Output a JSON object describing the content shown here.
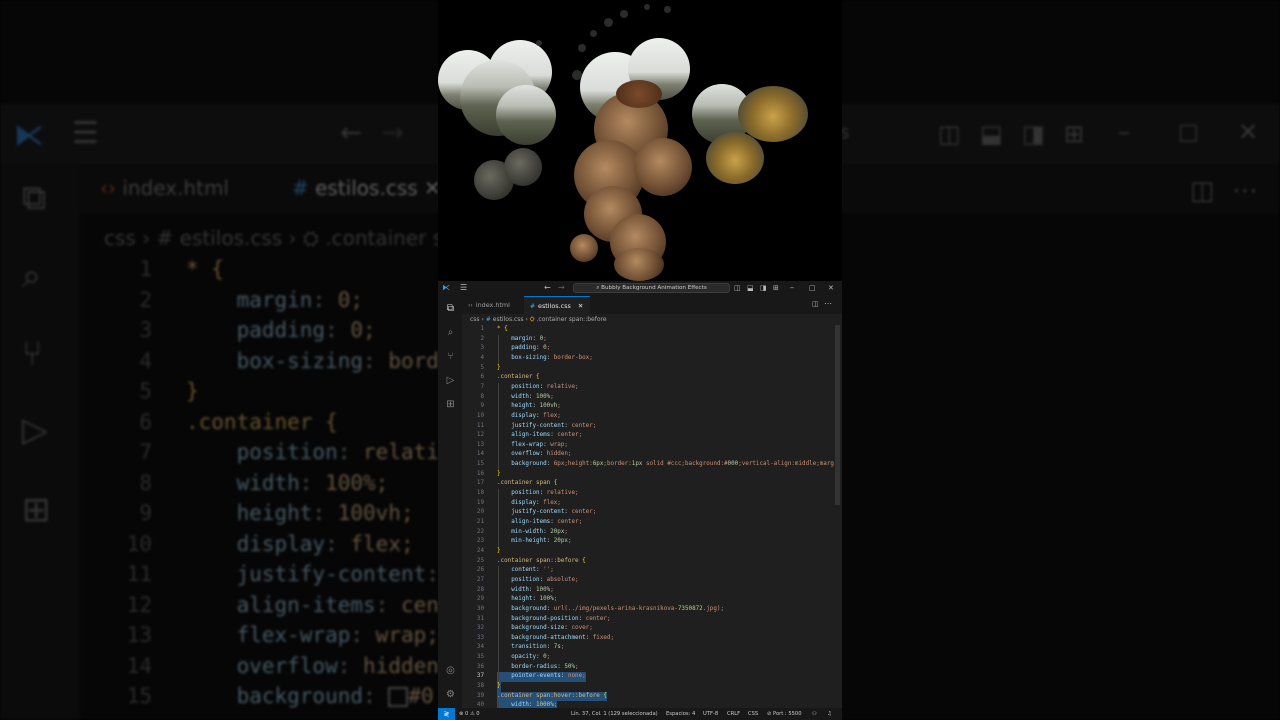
{
  "app": {
    "title": "Bubbly Background Animation Effects"
  },
  "tabs": [
    {
      "label": "index.html",
      "icon": "html-file-icon",
      "active": false
    },
    {
      "label": "estilos.css",
      "icon": "css-file-icon",
      "active": true,
      "close": "✕"
    }
  ],
  "breadcrumb": {
    "folder": "css",
    "file": "estilos.css",
    "symbol": ".container span::before",
    "sep": "›"
  },
  "editor": {
    "lines": [
      {
        "n": "1",
        "code": "* {"
      },
      {
        "n": "2",
        "code": "    margin: 0;"
      },
      {
        "n": "3",
        "code": "    padding: 0;"
      },
      {
        "n": "4",
        "code": "    box-sizing: border-box;"
      },
      {
        "n": "5",
        "code": "}"
      },
      {
        "n": "6",
        "code": ".container {"
      },
      {
        "n": "7",
        "code": "    position: relative;"
      },
      {
        "n": "8",
        "code": "    width: 100%;"
      },
      {
        "n": "9",
        "code": "    height: 100vh;"
      },
      {
        "n": "10",
        "code": "    display: flex;"
      },
      {
        "n": "11",
        "code": "    justify-content: center;"
      },
      {
        "n": "12",
        "code": "    align-items: center;"
      },
      {
        "n": "13",
        "code": "    flex-wrap: wrap;"
      },
      {
        "n": "14",
        "code": "    overflow: hidden;"
      },
      {
        "n": "15",
        "code": "    background: ■#000;"
      },
      {
        "n": "16",
        "code": "}"
      },
      {
        "n": "17",
        "code": ".container span {"
      },
      {
        "n": "18",
        "code": "    position: relative;"
      },
      {
        "n": "19",
        "code": "    display: flex;"
      },
      {
        "n": "20",
        "code": "    justify-content: center;"
      },
      {
        "n": "21",
        "code": "    align-items: center;"
      },
      {
        "n": "22",
        "code": "    min-width: 20px;"
      },
      {
        "n": "23",
        "code": "    min-height: 20px;"
      },
      {
        "n": "24",
        "code": "}"
      },
      {
        "n": "25",
        "code": ".container span::before {"
      },
      {
        "n": "26",
        "code": "    content: '';"
      },
      {
        "n": "27",
        "code": "    position: absolute;"
      },
      {
        "n": "28",
        "code": "    width: 100%;"
      },
      {
        "n": "29",
        "code": "    height: 100%;"
      },
      {
        "n": "30",
        "code": "    background: url(../img/pexels-arina-krasnikova-7350872.jpg);"
      },
      {
        "n": "31",
        "code": "    background-position: center;"
      },
      {
        "n": "32",
        "code": "    background-size: cover;"
      },
      {
        "n": "33",
        "code": "    background-attachment: fixed;"
      },
      {
        "n": "34",
        "code": "    transition: 7s;"
      },
      {
        "n": "35",
        "code": "    opacity: 0;"
      },
      {
        "n": "36",
        "code": "    border-radius: 50%;"
      },
      {
        "n": "37",
        "code": "    pointer-events: none;"
      },
      {
        "n": "38",
        "code": "}"
      },
      {
        "n": "39",
        "code": ".container span:hover::before {"
      },
      {
        "n": "40",
        "code": "    width: 1000%;"
      }
    ],
    "current_line": "37",
    "selected_lines": [
      "37",
      "38",
      "39",
      "40"
    ]
  },
  "status": {
    "remote": "≷",
    "problems": "⊗ 0 ⚠ 0",
    "position": "Lín. 37, Col. 1 (129 seleccionada)",
    "spaces": "Espacios: 4",
    "encoding": "UTF-8",
    "eol": "CRLF",
    "language": "CSS",
    "port": "Port : 5500"
  },
  "background": {
    "tabs": [
      {
        "label": "index.html"
      },
      {
        "label": "estilos.css"
      }
    ],
    "crumb": "css  ›  #  estilos.css  ›  ⛭ .container s",
    "lines": [
      {
        "n": "1",
        "code": "* {"
      },
      {
        "n": "2",
        "code": "    margin: 0;"
      },
      {
        "n": "3",
        "code": "    padding: 0;"
      },
      {
        "n": "4",
        "code": "    box-sizing: borde"
      },
      {
        "n": "5",
        "code": "}"
      },
      {
        "n": "6",
        "code": ".container {"
      },
      {
        "n": "7",
        "code": "    position: relativ"
      },
      {
        "n": "8",
        "code": "    width: 100%;"
      },
      {
        "n": "9",
        "code": "    height: 100vh;"
      },
      {
        "n": "10",
        "code": "    display: flex;"
      },
      {
        "n": "11",
        "code": "    justify-content:"
      },
      {
        "n": "12",
        "code": "    align-items: cent"
      },
      {
        "n": "13",
        "code": "    flex-wrap: wrap;"
      },
      {
        "n": "14",
        "code": "    overflow: hidden;"
      },
      {
        "n": "15",
        "code": "    background: ■#0"
      }
    ],
    "search_hint": "s"
  },
  "colors": {
    "accent": "#0078d4",
    "editor_bg": "#1f1f1f",
    "chrome_bg": "#181818",
    "selection": "#264f78"
  }
}
